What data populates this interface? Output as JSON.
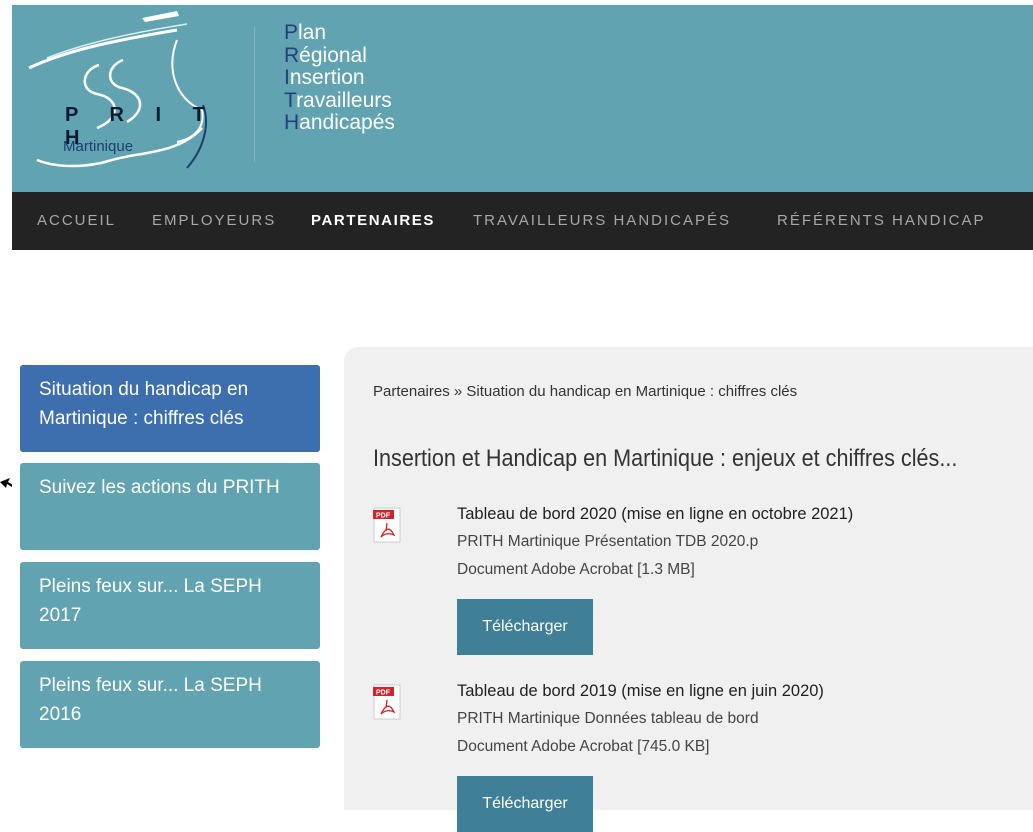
{
  "header": {
    "logo": {
      "mark_text": "P R I T H",
      "subtext": "Martinique"
    },
    "tagline": [
      {
        "initial": "P",
        "rest": "lan"
      },
      {
        "initial": "R",
        "rest": "égional"
      },
      {
        "initial": "I",
        "rest": "nsertion"
      },
      {
        "initial": "T",
        "rest": "ravailleurs"
      },
      {
        "initial": "H",
        "rest": "andicapés"
      }
    ]
  },
  "nav": {
    "items": [
      "ACCUEIL",
      "EMPLOYEURS",
      "PARTENAIRES",
      "TRAVAILLEURS HANDICAPÉS",
      "RÉFÉRENTS HANDICAP"
    ],
    "active_index": 2
  },
  "sidebar": {
    "items": [
      {
        "label": "Situation du handicap en Martinique : chiffres clés",
        "active": true
      },
      {
        "label": "Suivez les actions du PRITH",
        "active": false
      },
      {
        "label": "Pleins feux sur... La SEPH 2017",
        "active": false
      },
      {
        "label": "Pleins feux sur... La SEPH 2016",
        "active": false
      }
    ]
  },
  "main": {
    "breadcrumb": "Partenaires » Situation du handicap en Martinique : chiffres clés",
    "heading": "Insertion et Handicap en Martinique : enjeux et chiffres clés...",
    "documents": [
      {
        "title": "Tableau de bord 2020 (mise en ligne en octobre 2021)",
        "filename": "PRITH Martinique Présentation TDB 2020.p",
        "filetype": "Document Adobe Acrobat [1.3 MB]",
        "button": "Télécharger",
        "icon": "pdf-icon"
      },
      {
        "title": "Tableau de bord 2019 (mise en ligne en juin 2020)",
        "filename": "PRITH Martinique Données tableau de bord",
        "filetype": "Document Adobe Acrobat [745.0 KB]",
        "button": "Télécharger",
        "icon": "pdf-icon"
      }
    ]
  },
  "colors": {
    "header_bg": "#62a3b2",
    "nav_bg": "#232323",
    "sidebar_active": "#3d6eae",
    "sidebar_item": "#62a3b2",
    "button": "#3f7f97",
    "content_bg": "#f0f0f0"
  }
}
